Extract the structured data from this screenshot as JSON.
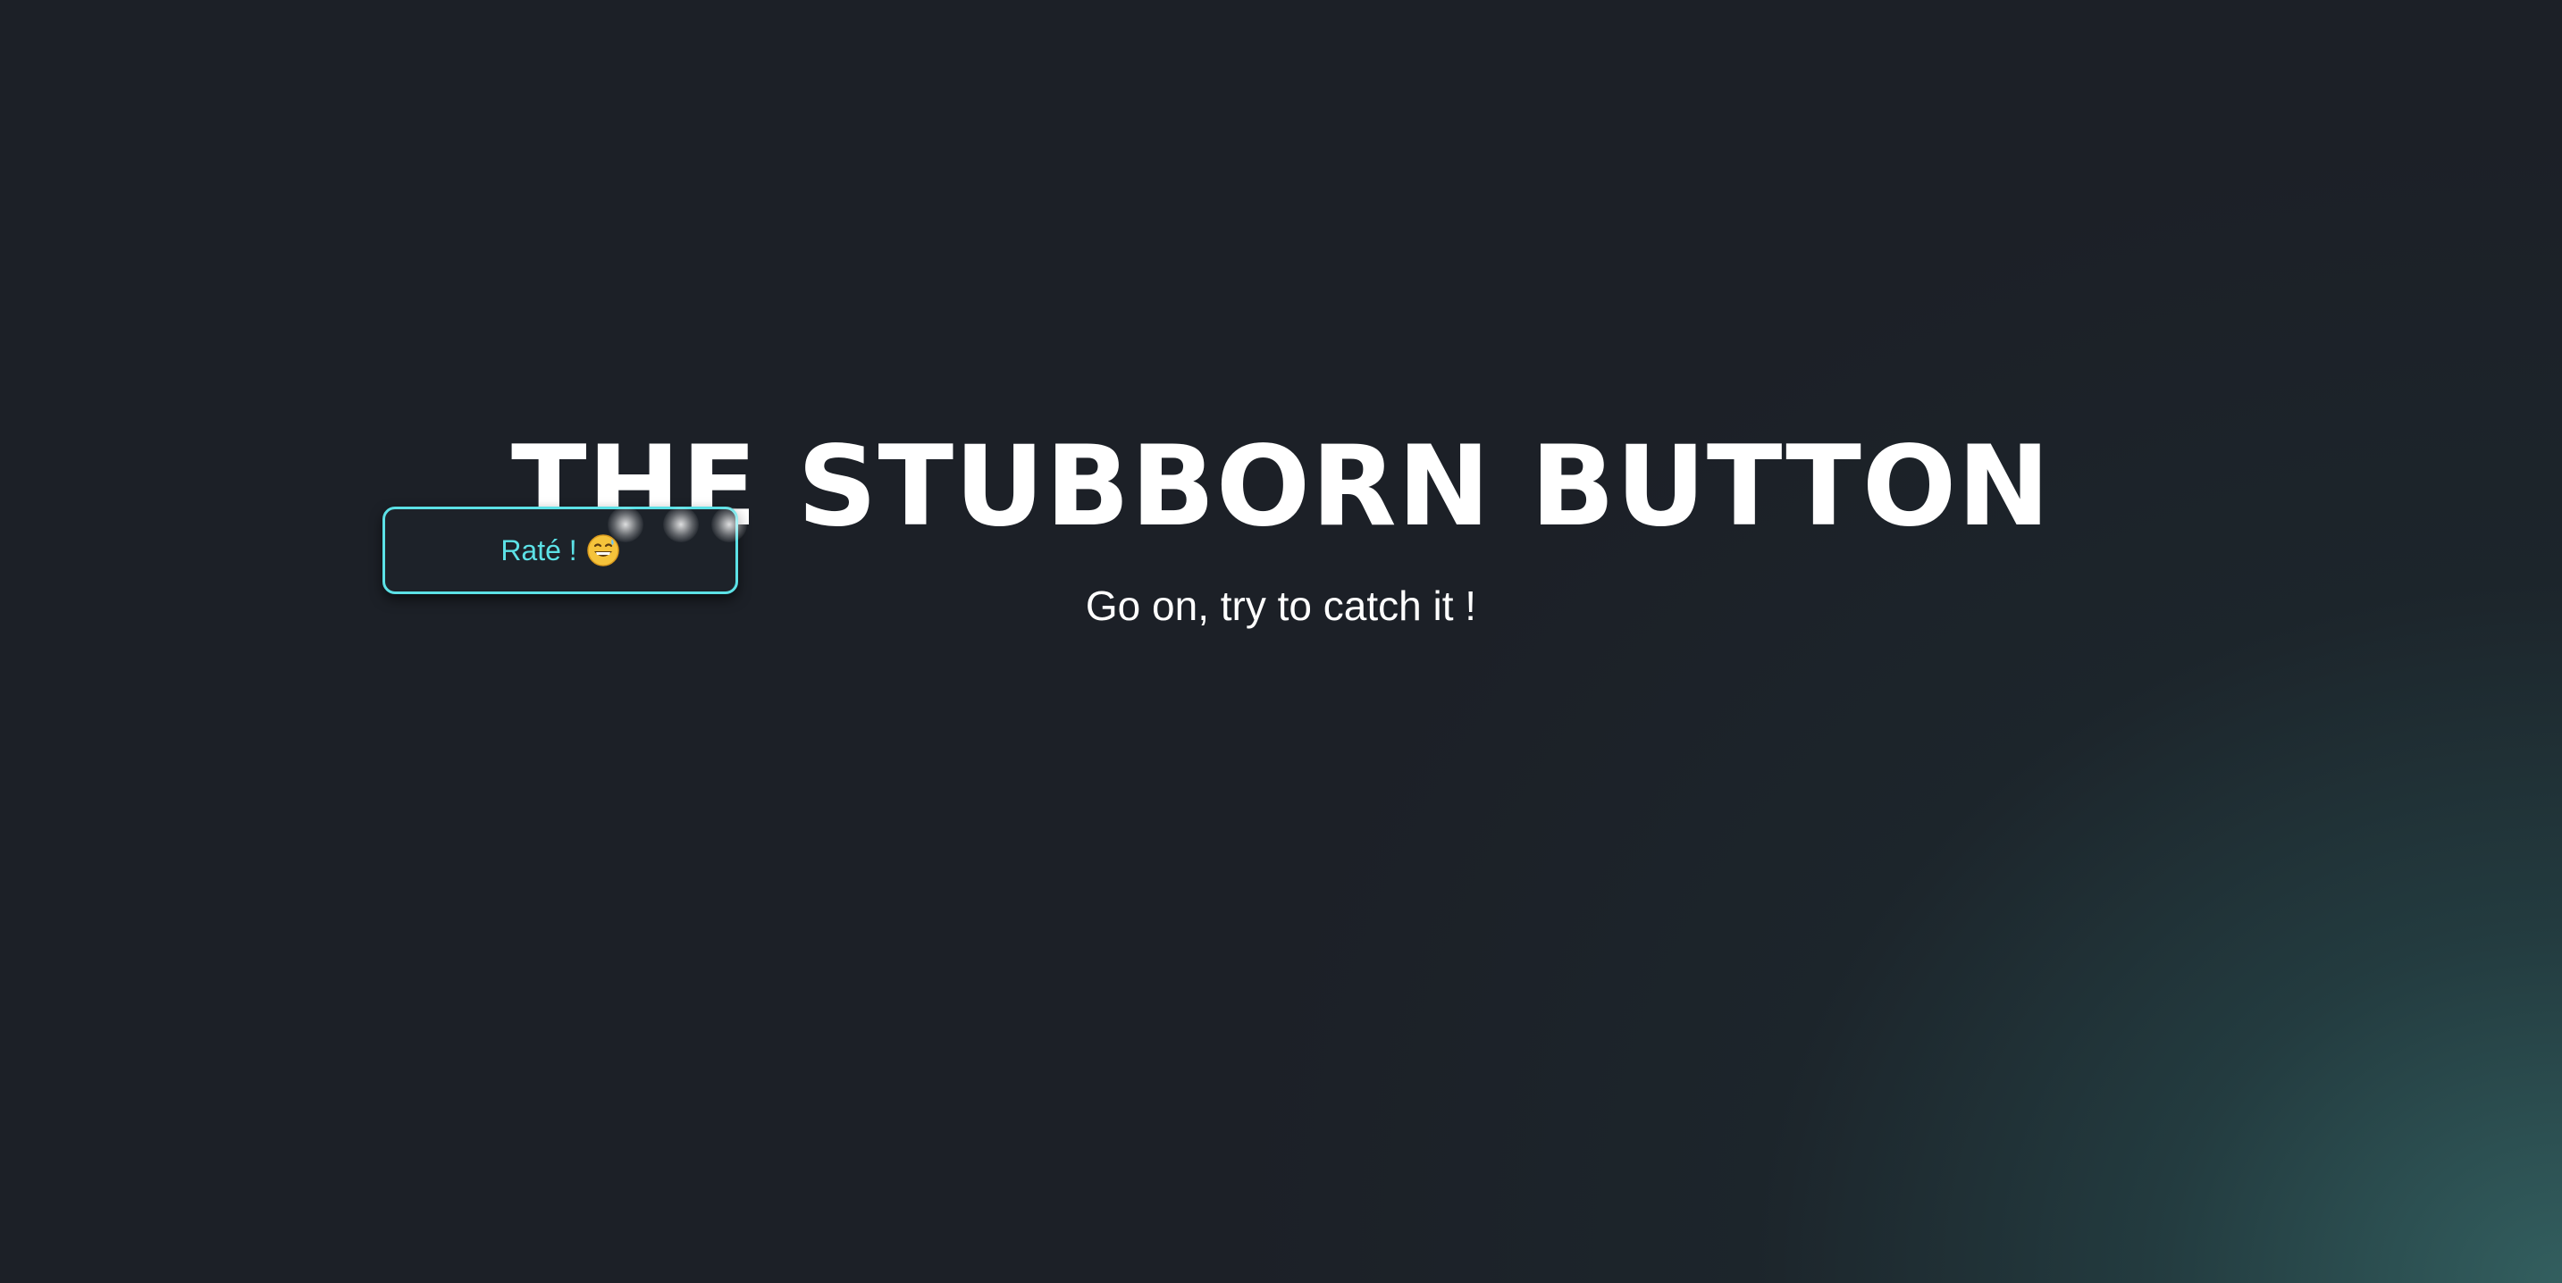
{
  "page": {
    "title": "THE STUBBORN BUTTON",
    "subtitle": "Go on, try to catch it !"
  },
  "button": {
    "label": "Raté !",
    "icon": "grinning-sweat-emoji-icon"
  },
  "colors": {
    "background": "#1c2027",
    "glow": "#346262",
    "accent": "#5ce1e6",
    "text": "#ffffff"
  }
}
